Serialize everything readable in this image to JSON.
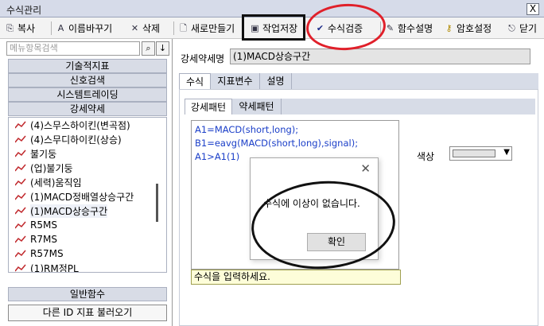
{
  "window": {
    "title": "수식관리",
    "close_glyph": "X"
  },
  "toolbar": {
    "items": [
      {
        "label": "복사",
        "icon": "copy-icon",
        "glyph": "⎘"
      },
      {
        "label": "이름바꾸기",
        "icon": "rename-icon",
        "glyph": "A"
      },
      {
        "label": "삭제",
        "icon": "delete-icon",
        "glyph": "✕"
      },
      {
        "label": "새로만들기",
        "icon": "new-document-icon",
        "glyph": "🗋"
      },
      {
        "label": "작업저장",
        "icon": "save-icon",
        "glyph": "▣"
      },
      {
        "label": "수식검증",
        "icon": "checkmark-icon",
        "glyph": "✔"
      },
      {
        "label": "함수설명",
        "icon": "function-help-icon",
        "glyph": "✎"
      },
      {
        "label": "암호설정",
        "icon": "key-icon",
        "glyph": "⚷"
      },
      {
        "label": "닫기",
        "icon": "close-door-icon",
        "glyph": "⎋"
      }
    ]
  },
  "left": {
    "search_placeholder": "메뉴항목검색",
    "categories": [
      "기술적지표",
      "신호검색",
      "시스템트레이딩",
      "강세약세"
    ],
    "tree_items": [
      "(4)스무스하이킨(변곡점)",
      "(4)스무디하이킨(상승)",
      "불기둥",
      "(업)불기둥",
      "(세력)움직임",
      "(1)MACD정배열상승구간",
      "(1)MACD상승구간",
      "R5MS",
      "R7MS",
      "R57MS",
      "(1)RM정PL"
    ],
    "general_functions": "일반함수",
    "load_button": "다른 ID 지표 불러오기"
  },
  "right": {
    "name_label": "강세약세명",
    "name_value": "(1)MACD상승구간",
    "tabs": [
      "수식",
      "지표변수",
      "설명"
    ],
    "subtabs": [
      "강세패턴",
      "약세패턴"
    ],
    "formula_lines": [
      "A1=MACD(short,long);",
      "B1=eavg(MACD(short,long),signal);",
      "",
      "A1>A1(1)"
    ],
    "hint": "수식을 입력하세요.",
    "color_label": "색상",
    "color_arrow": "▼"
  },
  "dialog": {
    "close_glyph": "✕",
    "message": "수식에 이상이 없습니다.",
    "ok_label": "확인"
  },
  "colors": {
    "annotation_red": "#e0202a",
    "annotation_black": "#111111",
    "formula_text": "#1a3ec8"
  }
}
